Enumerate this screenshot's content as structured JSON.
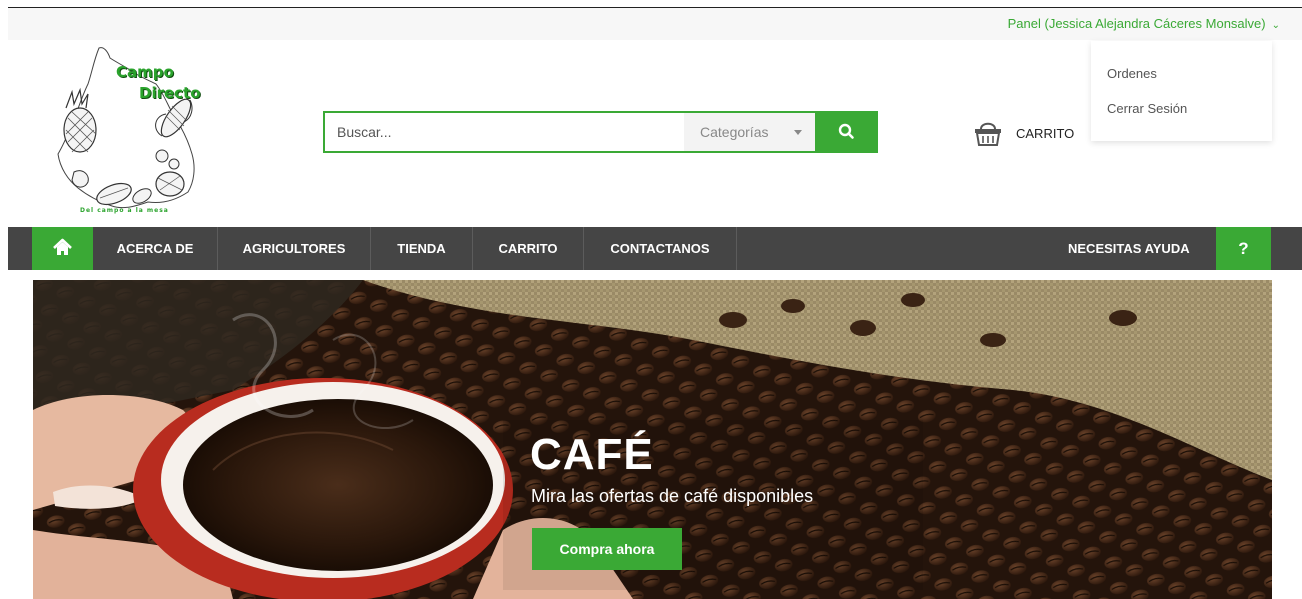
{
  "topbar": {
    "panel_label": "Panel (Jessica Alejandra Cáceres Monsalve)",
    "chevron_icon": "chevron-down-icon"
  },
  "user_menu": {
    "items": [
      {
        "label": "Ordenes"
      },
      {
        "label": "Cerrar Sesión"
      }
    ]
  },
  "logo": {
    "line1": "Campo",
    "line2": "Directo",
    "tagline": "Del campo a la mesa"
  },
  "search": {
    "placeholder": "Buscar...",
    "category_label": "Categorías",
    "button_icon": "search-icon"
  },
  "cart": {
    "label": "CARRITO",
    "icon": "basket-icon"
  },
  "nav": {
    "home_icon": "home-icon",
    "items": [
      {
        "label": "ACERCA DE"
      },
      {
        "label": "AGRICULTORES"
      },
      {
        "label": "TIENDA"
      },
      {
        "label": "CARRITO"
      },
      {
        "label": "CONTACTANOS"
      }
    ],
    "help_label": "NECESITAS AYUDA",
    "help_button": "?"
  },
  "hero": {
    "title": "CAFÉ",
    "subtitle": "Mira las ofertas de café disponibles",
    "cta": "Compra ahora"
  },
  "colors": {
    "accent": "#3aa935",
    "nav_bg": "#454545",
    "topbar_bg": "#f7f7f7"
  }
}
